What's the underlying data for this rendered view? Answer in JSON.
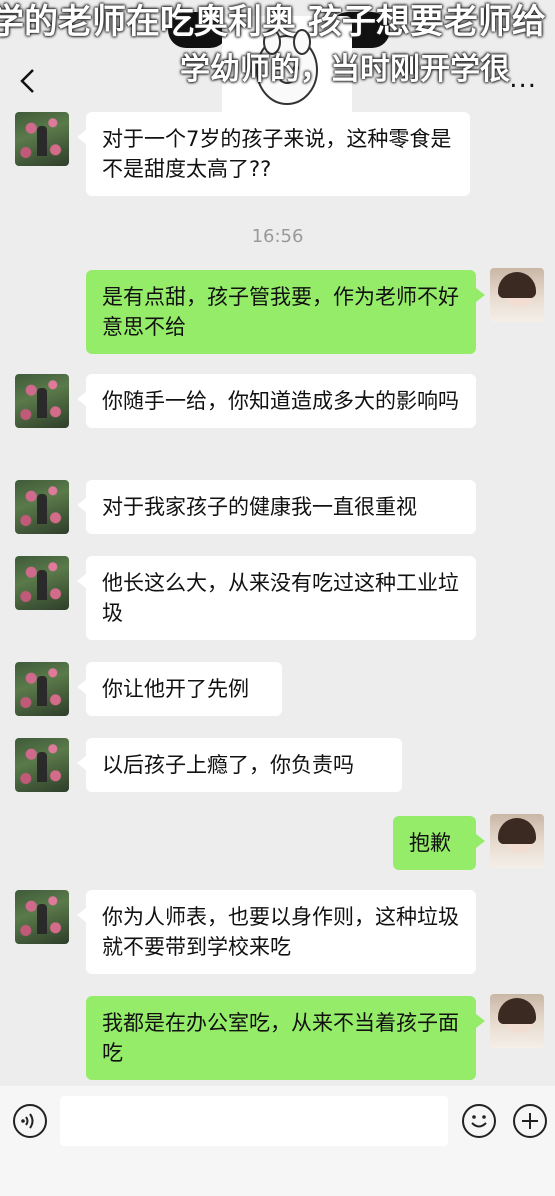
{
  "overlay": {
    "line1": "学的老师在吃奥利奥 孩子想要老师给",
    "line2": "学幼师的，当时刚开学很"
  },
  "nav": {
    "back_icon": "chevron-left-icon",
    "more_label": "..."
  },
  "messages": [
    {
      "side": "in",
      "text": "对于一个7岁的孩子来说，这种零食是不是甜度太高了??"
    },
    {
      "side": "time",
      "text": "16:56"
    },
    {
      "side": "out",
      "text": "是有点甜，孩子管我要，作为老师不好意思不给"
    },
    {
      "side": "in",
      "text": "你随手一给，你知道造成多大的影响吗"
    },
    {
      "side": "in",
      "text": "对于我家孩子的健康我一直很重视"
    },
    {
      "side": "in",
      "text": "他长这么大，从来没有吃过这种工业垃圾"
    },
    {
      "side": "in",
      "text": "你让他开了先例"
    },
    {
      "side": "in",
      "text": "以后孩子上瘾了，你负责吗"
    },
    {
      "side": "out",
      "text": "抱歉"
    },
    {
      "side": "in",
      "text": "你为人师表，也要以身作则，这种垃圾就不要带到学校来吃"
    },
    {
      "side": "out",
      "text": "我都是在办公室吃，从来不当着孩子面吃"
    }
  ],
  "input_bar": {
    "voice_icon": "voice-icon",
    "emoji_icon": "emoji-icon",
    "plus_icon": "plus-icon"
  },
  "colors": {
    "background": "#ededed",
    "outgoing_bubble": "#95ec69",
    "incoming_bubble": "#ffffff"
  }
}
